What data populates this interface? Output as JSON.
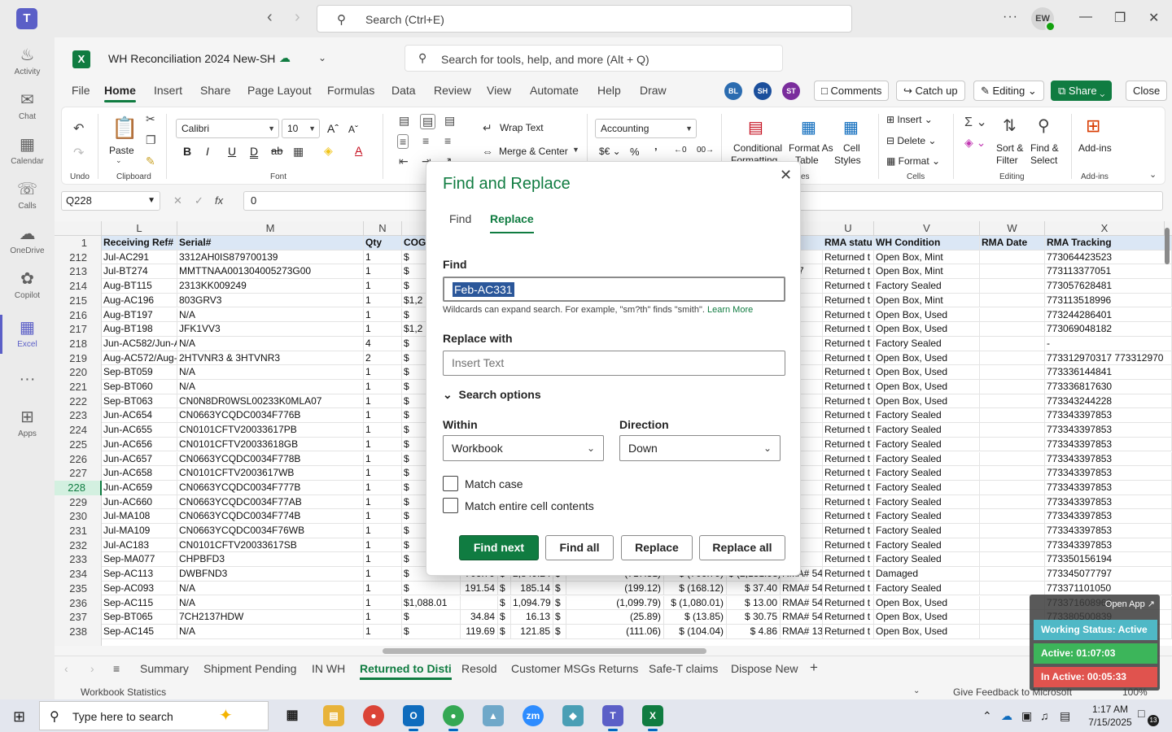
{
  "teams": {
    "search_placeholder": "Search (Ctrl+E)",
    "avatar": "EW",
    "sidebar": [
      {
        "label": "Activity",
        "icon": "bell-icon"
      },
      {
        "label": "Chat",
        "icon": "chat-icon"
      },
      {
        "label": "Calendar",
        "icon": "calendar-icon"
      },
      {
        "label": "Calls",
        "icon": "phone-icon"
      },
      {
        "label": "OneDrive",
        "icon": "cloud-icon"
      },
      {
        "label": "Copilot",
        "icon": "copilot-icon"
      },
      {
        "label": "Excel",
        "icon": "excel-icon"
      },
      {
        "label": "Apps",
        "icon": "apps-icon"
      }
    ]
  },
  "excel": {
    "title": "WH Reconciliation 2024 New-SH",
    "search_placeholder": "Search for tools, help, and more (Alt + Q)",
    "menu": [
      "File",
      "Home",
      "Insert",
      "Share",
      "Page Layout",
      "Formulas",
      "Data",
      "Review",
      "View",
      "Automate",
      "Help",
      "Draw"
    ],
    "active_menu": "Home",
    "collaborators": [
      {
        "initials": "BL",
        "color": "#2b6cb0"
      },
      {
        "initials": "SH",
        "color": "#1b4f9c"
      },
      {
        "initials": "ST",
        "color": "#7a2d9c"
      }
    ],
    "buttons": {
      "comments": "Comments",
      "catch_up": "Catch up",
      "editing": "Editing",
      "share": "Share",
      "close": "Close"
    },
    "ribbon": {
      "undo": "Undo",
      "paste": "Paste",
      "clipboard": "Clipboard",
      "font_name": "Calibri",
      "font_size": "10",
      "font": "Font",
      "wrap_text": "Wrap Text",
      "merge_center": "Merge & Center",
      "number_format": "Accounting",
      "conditional_formatting": "Conditional Formatting",
      "conditional_line1": "Conditional",
      "conditional_line2": "Formatting",
      "format_as_table_line1": "Format As",
      "format_as_table_line2": "Table",
      "cell_styles_line1": "Cell",
      "cell_styles_line2": "Styles",
      "styles_fragment": "es",
      "insert": "Insert",
      "delete": "Delete",
      "format": "Format",
      "cells": "Cells",
      "sort_filter_line1": "Sort &",
      "sort_filter_line2": "Filter",
      "find_select_line1": "Find &",
      "find_select_line2": "Select",
      "editing_group": "Editing",
      "addins": "Add-ins",
      "addins_group": "Add-ins"
    },
    "name_box": "Q228",
    "formula_value": "0",
    "columns_left": [
      "L",
      "M",
      "N",
      "O"
    ],
    "columns_left_display": [
      "L",
      "M",
      "N",
      "COG"
    ],
    "columns_right": [
      "U",
      "V",
      "W",
      "X"
    ],
    "header_row": {
      "num": "1",
      "L": "Receiving Ref#",
      "M": "Serial#",
      "N": "Qty",
      "O": "COG",
      "U": "RMA statu",
      "V": "WH Condition",
      "W": "RMA Date",
      "X": "RMA Tracking"
    },
    "rows": [
      {
        "num": "212",
        "L": "Jul-AC291",
        "M": "3312AH0IS879700139",
        "N": "1",
        "O": "$",
        "P": "",
        "Q": "",
        "R": "",
        "S": "",
        "T": "3-C",
        "U": "Returned t",
        "V": "Open Box, Mint",
        "W": "",
        "X": "773064423523"
      },
      {
        "num": "213",
        "L": "Jul-BT274",
        "M": "MMTTNAA001304005273G00",
        "N": "1",
        "O": "$",
        "P": "",
        "Q": "",
        "R": "",
        "S": "",
        "T": "0177",
        "U": "Returned t",
        "V": "Open Box, Mint",
        "W": "",
        "X": "773113377051"
      },
      {
        "num": "214",
        "L": "Aug-BT115",
        "M": "2313KK009249",
        "N": "1",
        "O": "$",
        "P": "",
        "Q": "",
        "R": "",
        "S": "",
        "T": "1-C",
        "U": "Returned t",
        "V": "Factory Sealed",
        "W": "",
        "X": "773057628481"
      },
      {
        "num": "215",
        "L": "Aug-AC196",
        "M": "803GRV3",
        "N": "1",
        "O": "$1,2",
        "P": "",
        "Q": "",
        "R": "",
        "S": "",
        "T": "4",
        "U": "Returned t",
        "V": "Open Box, Mint",
        "W": "",
        "X": "773113518996"
      },
      {
        "num": "216",
        "L": "Aug-BT197",
        "M": "N/A",
        "N": "1",
        "O": "$",
        "P": "",
        "Q": "",
        "R": "",
        "S": "",
        "T": "3-C",
        "U": "Returned t",
        "V": "Open Box, Used",
        "W": "",
        "X": "773244286401"
      },
      {
        "num": "217",
        "L": "Aug-BT198",
        "M": "JFK1VV3",
        "N": "1",
        "O": "$1,2",
        "P": "",
        "Q": "",
        "R": "",
        "S": "",
        "T": "4-C",
        "U": "Returned t",
        "V": "Open Box, Used",
        "W": "",
        "X": "773069048182"
      },
      {
        "num": "218",
        "L": "Jun-AC582/Jun-A",
        "M": "N/A",
        "N": "4",
        "O": "$",
        "P": "",
        "Q": "",
        "R": "",
        "S": "",
        "T": "9-C",
        "U": "Returned t",
        "V": "Factory Sealed",
        "W": "",
        "X": "-"
      },
      {
        "num": "219",
        "L": "Aug-AC572/Aug-",
        "M": "2HTVNR3 & 3HTVNR3",
        "N": "2",
        "O": "$",
        "P": "",
        "Q": "",
        "R": "",
        "S": "",
        "T": "3",
        "U": "Returned t",
        "V": "Open Box, Used",
        "W": "",
        "X": "773312970317  773312970"
      },
      {
        "num": "220",
        "L": "Sep-BT059",
        "M": "N/A",
        "N": "1",
        "O": "$",
        "P": "",
        "Q": "",
        "R": "",
        "S": "",
        "T": "3",
        "U": "Returned t",
        "V": "Open Box, Used",
        "W": "",
        "X": "773336144841"
      },
      {
        "num": "221",
        "L": "Sep-BT060",
        "M": "N/A",
        "N": "1",
        "O": "$",
        "P": "",
        "Q": "",
        "R": "",
        "S": "",
        "T": "4-C",
        "U": "Returned t",
        "V": "Open Box, Used",
        "W": "",
        "X": "773336817630"
      },
      {
        "num": "222",
        "L": "Sep-BT063",
        "M": "CN0N8DR0WSL00233K0MLA07",
        "N": "1",
        "O": "$",
        "P": "",
        "Q": "",
        "R": "",
        "S": "",
        "T": "4-C",
        "U": "Returned t",
        "V": "Open Box, Used",
        "W": "",
        "X": "773343244228"
      },
      {
        "num": "223",
        "L": "Jun-AC654",
        "M": "CN0663YCQDC0034F776B",
        "N": "1",
        "O": "$",
        "P": "",
        "Q": "",
        "R": "",
        "S": "",
        "T": "2-C",
        "U": "Returned t",
        "V": "Factory Sealed",
        "W": "",
        "X": "773343397853"
      },
      {
        "num": "224",
        "L": "Jun-AC655",
        "M": "CN0101CFTV20033617PB",
        "N": "1",
        "O": "$",
        "P": "",
        "Q": "",
        "R": "",
        "S": "",
        "T": "2-C",
        "U": "Returned t",
        "V": "Factory Sealed",
        "W": "",
        "X": "773343397853"
      },
      {
        "num": "225",
        "L": "Jun-AC656",
        "M": "CN0101CFTV20033618GB",
        "N": "1",
        "O": "$",
        "P": "",
        "Q": "",
        "R": "",
        "S": "",
        "T": "2-C",
        "U": "Returned t",
        "V": "Factory Sealed",
        "W": "",
        "X": "773343397853"
      },
      {
        "num": "226",
        "L": "Jun-AC657",
        "M": "CN0663YCQDC0034F778B",
        "N": "1",
        "O": "$",
        "P": "",
        "Q": "",
        "R": "",
        "S": "",
        "T": "2-C",
        "U": "Returned t",
        "V": "Factory Sealed",
        "W": "",
        "X": "773343397853"
      },
      {
        "num": "227",
        "L": "Jun-AC658",
        "M": "CN0101CFTV2003617WB",
        "N": "1",
        "O": "$",
        "P": "",
        "Q": "",
        "R": "",
        "S": "",
        "T": "2-C",
        "U": "Returned t",
        "V": "Factory Sealed",
        "W": "",
        "X": "773343397853"
      },
      {
        "num": "228",
        "L": "Jun-AC659",
        "M": "CN0663YCQDC0034F777B",
        "N": "1",
        "O": "$",
        "P": "",
        "Q": "",
        "R": "",
        "S": "",
        "T": "2-C",
        "U": "Returned t",
        "V": "Factory Sealed",
        "W": "",
        "X": "773343397853",
        "selected": true
      },
      {
        "num": "229",
        "L": "Jun-AC660",
        "M": "CN0663YCQDC0034F77AB",
        "N": "1",
        "O": "$",
        "P": "",
        "Q": "",
        "R": "",
        "S": "",
        "T": "2-C",
        "U": "Returned t",
        "V": "Factory Sealed",
        "W": "",
        "X": "773343397853"
      },
      {
        "num": "230",
        "L": "Jul-MA108",
        "M": "CN0663YCQDC0034F774B",
        "N": "1",
        "O": "$",
        "P": "",
        "Q": "",
        "R": "",
        "S": "",
        "T": "2-C",
        "U": "Returned t",
        "V": "Factory Sealed",
        "W": "",
        "X": "773343397853"
      },
      {
        "num": "231",
        "L": "Jul-MA109",
        "M": "CN0663YCQDC0034F76WB",
        "N": "1",
        "O": "$",
        "P": "",
        "Q": "",
        "R": "",
        "S": "",
        "T": "2-C",
        "U": "Returned t",
        "V": "Factory Sealed",
        "W": "",
        "X": "773343397853"
      },
      {
        "num": "232",
        "L": "Jul-AC183",
        "M": "CN0101CFTV20033617SB",
        "N": "1",
        "O": "$",
        "P": "",
        "Q": "",
        "R": "",
        "S": "",
        "T": "2-C",
        "U": "Returned t",
        "V": "Factory Sealed",
        "W": "",
        "X": "773343397853"
      },
      {
        "num": "233",
        "L": "Sep-MA077",
        "M": "CHPBFD3",
        "N": "1",
        "O": "$",
        "P": "",
        "Q": "",
        "R": "",
        "S": "",
        "T": "0",
        "U": "Returned t",
        "V": "Factory Sealed",
        "W": "",
        "X": "773350156194"
      },
      {
        "num": "234",
        "L": "Sep-AC113",
        "M": "DWBFND3",
        "N": "1",
        "O": "$",
        "P": "706.79",
        "Q": "$",
        "R": "2,849.24",
        "S": "$",
        "T": "(717.31)",
        "T2": "$ (706.79)",
        "T3": "$ (2,131.93)",
        "T4": "RMA# 5442089-C",
        "U": "Returned t",
        "V": "Damaged",
        "W": "",
        "X": "773345077797"
      },
      {
        "num": "235",
        "L": "Sep-AC093",
        "M": "N/A",
        "N": "1",
        "O": "$",
        "P": "191.54",
        "Q": "$",
        "R": "185.14",
        "S": "$",
        "T": "(199.12)",
        "T2": "$ (168.12)",
        "T3": "$ 37.40",
        "T4": "RMA# 5443446",
        "U": "Returned t",
        "V": "Factory Sealed",
        "W": "",
        "X": "773371101050"
      },
      {
        "num": "236",
        "L": "Sep-AC115",
        "M": "N/A",
        "N": "1",
        "O": "$1,088.01",
        "P": "",
        "Q": "$",
        "R": "1,094.79",
        "S": "$",
        "T": "(1,099.79)",
        "T2": "$ (1,080.01)",
        "T3": "$ 13.00",
        "T4": "RMA# 5443475-C",
        "U": "Returned t",
        "V": "Open Box, Used",
        "W": "",
        "X": "773371608963"
      },
      {
        "num": "237",
        "L": "Sep-BT065",
        "M": "7CH2137HDW",
        "N": "1",
        "O": "$",
        "P": "34.84",
        "Q": "$",
        "R": "16.13",
        "S": "$",
        "T": "(25.89)",
        "T2": "$ (13.85)",
        "T3": "$ 30.75",
        "T4": "RMA# 5443854-C",
        "U": "Returned t",
        "V": "Open Box, Used",
        "W": "",
        "X": "773380500839"
      },
      {
        "num": "238",
        "L": "Sep-AC145",
        "M": "N/A",
        "N": "1",
        "O": "$",
        "P": "119.69",
        "Q": "$",
        "R": "121.85",
        "S": "$",
        "T": "(111.06)",
        "T2": "$ (104.04)",
        "T3": "$ 4.86",
        "T4": "RMA# 1323952",
        "U": "Returned t",
        "V": "Open Box, Used",
        "W": "",
        "X": "773442557859"
      }
    ],
    "sheets": [
      "Summary",
      "Shipment Pending",
      "IN WH",
      "Returned to Disti",
      "Resold",
      "Customer MSGs Returns",
      "Safe-T claims",
      "Dispose New"
    ],
    "active_sheet": "Returned to Disti",
    "status_left": "Workbook Statistics",
    "status_feedback": "Give Feedback to Microsoft",
    "zoom": "100%"
  },
  "dialog": {
    "title": "Find and Replace",
    "tab_find": "Find",
    "tab_replace": "Replace",
    "find_label": "Find",
    "find_value": "Feb-AC331",
    "hint": "Wildcards can expand search. For example, \"sm?th\" finds \"smith\".",
    "hint_link": "Learn More",
    "replace_label": "Replace with",
    "replace_placeholder": "Insert Text",
    "search_options": "Search options",
    "within_label": "Within",
    "within_value": "Workbook",
    "direction_label": "Direction",
    "direction_value": "Down",
    "match_case": "Match case",
    "match_entire": "Match entire cell contents",
    "btn_find_next": "Find next",
    "btn_find_all": "Find all",
    "btn_replace": "Replace",
    "btn_replace_all": "Replace all"
  },
  "widget": {
    "open_app": "Open App",
    "status": "Working Status: Active",
    "active": "Active: 01:07:03",
    "inactive": "In Active: 00:05:33",
    "status_color": "#4fb8c6",
    "active_color": "#3cb55a",
    "inactive_color": "#e0534e"
  },
  "taskbar": {
    "search_placeholder": "Type here to search",
    "time": "1:17 AM",
    "date": "7/15/2025",
    "notifications": "13"
  }
}
